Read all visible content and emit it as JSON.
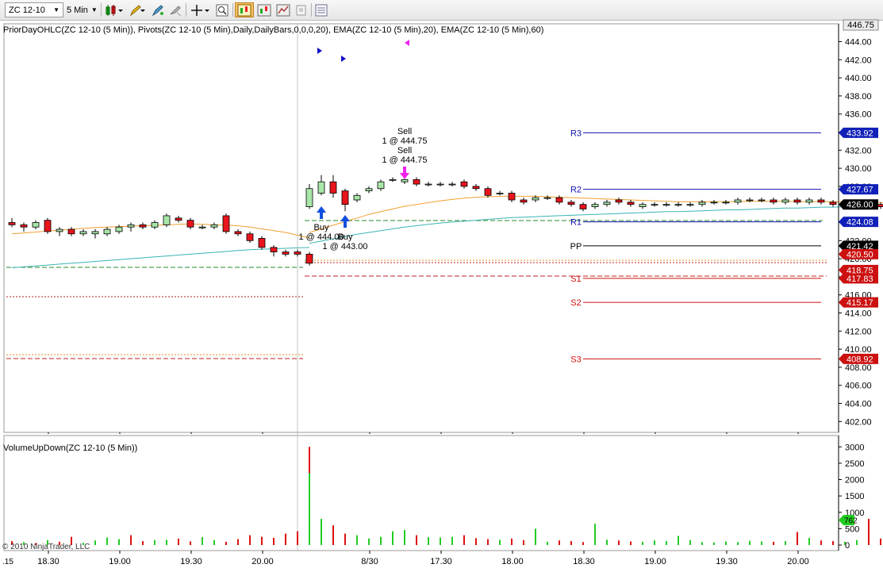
{
  "toolbar": {
    "instrument": "ZC 12-10",
    "interval": "5 Min",
    "icons": [
      "bar-type-icon",
      "drawing-pencil-icon",
      "crosshair-icon",
      "zoom-icon",
      "properties-icon",
      "indicators-icon",
      "strategies-icon",
      "copy-icon",
      "data-box-icon"
    ]
  },
  "indicator_label_price": "PriorDayOHLC(ZC 12-10 (5 Min)), Pivots(ZC 12-10 (5 Min),Daily,DailyBars,0,0,0,20), EMA(ZC 12-10 (5 Min),20), EMA(ZC 12-10 (5 Min),60)",
  "indicator_label_volume": "VolumeUpDown(ZC 12-10 (5 Min))",
  "copyright": "© 2010 NinjaTrader, LLC",
  "left_edge_label": ".15",
  "colors": {
    "up_candle": "#a9e6a9",
    "down_candle": "#e8141c",
    "ema20": "#f0a030",
    "ema60": "#3cb4b4",
    "pivot_resistance": "#1010b0",
    "pivot_support": "#d01010",
    "pp": "#000000",
    "volume_up": "#22cc22",
    "volume_down": "#dd1111"
  },
  "chart_data": {
    "type": "candlestick",
    "price_axis": {
      "min": 401.5,
      "max": 446.75,
      "ticks": [
        446.75,
        444,
        442,
        440,
        438,
        436,
        434,
        432,
        430,
        428,
        426,
        424,
        422,
        420,
        418,
        416,
        414,
        412,
        410,
        408,
        406,
        404,
        402
      ]
    },
    "time_axis": {
      "labels": [
        "18.30",
        "19.00",
        "19.30",
        "20.00",
        "8/30",
        "17.30",
        "18.00",
        "18.30",
        "19.00",
        "19.30",
        "20.00"
      ]
    },
    "price_labels": [
      {
        "value": 433.92,
        "text": "433.92",
        "color": "#1020b8"
      },
      {
        "value": 427.67,
        "text": "427.67",
        "color": "#1020b8"
      },
      {
        "value": 426.0,
        "text": "426.00",
        "color": "#ffffff"
      },
      {
        "value": 424.08,
        "text": "424.08",
        "color": "#1020b8"
      },
      {
        "value": 421.42,
        "text": "421.42",
        "color": "#000000"
      },
      {
        "value": 420.5,
        "text": "420.50",
        "color": "#cc1010"
      },
      {
        "value": 418.75,
        "text": "418.75",
        "color": "#cc1010"
      },
      {
        "value": 417.83,
        "text": "417.83",
        "color": "#cc1010"
      },
      {
        "value": 415.17,
        "text": "415.17",
        "color": "#cc1010"
      },
      {
        "value": 408.92,
        "text": "408.92",
        "color": "#cc1010"
      }
    ],
    "pivots": [
      {
        "name": "R3",
        "value": 433.92
      },
      {
        "name": "R2",
        "value": 427.67
      },
      {
        "name": "R1",
        "value": 424.08
      },
      {
        "name": "PP",
        "value": 421.42
      },
      {
        "name": "S1",
        "value": 417.83
      },
      {
        "name": "S2",
        "value": 415.17
      },
      {
        "name": "S3",
        "value": 408.92
      }
    ],
    "trades": [
      {
        "label": "Sell",
        "detail": "1 @ 444.75"
      },
      {
        "label": "Sell",
        "detail": "1 @ 444.75"
      },
      {
        "label": "Buy",
        "detail": "1 @ 444.00"
      },
      {
        "label": "Buy",
        "detail": "1 @ 443.00"
      }
    ],
    "candles_day1": [
      [
        424.0,
        424.5,
        423.5,
        423.75
      ],
      [
        423.75,
        424.0,
        423.0,
        423.5
      ],
      [
        423.5,
        424.25,
        423.25,
        424.0
      ],
      [
        424.25,
        424.5,
        422.75,
        423.0
      ],
      [
        423.0,
        423.5,
        422.5,
        423.25
      ],
      [
        423.25,
        423.5,
        422.5,
        422.75
      ],
      [
        422.75,
        423.25,
        422.5,
        423.0
      ],
      [
        422.75,
        423.25,
        422.25,
        423.0
      ],
      [
        422.75,
        423.5,
        422.5,
        423.25
      ],
      [
        423.0,
        423.75,
        422.75,
        423.5
      ],
      [
        423.5,
        424.0,
        423.0,
        423.75
      ],
      [
        423.75,
        424.0,
        423.25,
        423.5
      ],
      [
        423.5,
        424.25,
        423.25,
        424.0
      ],
      [
        423.75,
        425.0,
        423.5,
        424.75
      ],
      [
        424.5,
        424.75,
        424.0,
        424.25
      ],
      [
        424.25,
        424.5,
        423.25,
        423.5
      ],
      [
        423.5,
        423.75,
        423.25,
        423.5
      ],
      [
        423.5,
        424.0,
        423.25,
        423.75
      ],
      [
        424.75,
        425.0,
        422.75,
        423.0
      ],
      [
        423.0,
        423.25,
        422.5,
        422.75
      ],
      [
        422.75,
        423.0,
        421.75,
        422.0
      ],
      [
        422.25,
        422.5,
        421.0,
        421.25
      ],
      [
        421.25,
        421.5,
        420.25,
        420.75
      ],
      [
        420.75,
        421.0,
        420.25,
        420.5
      ],
      [
        420.75,
        421.0,
        420.25,
        420.5
      ],
      [
        420.5,
        420.75,
        419.25,
        419.5
      ]
    ],
    "candles_day2": [
      [
        425.75,
        428.25,
        425.5,
        427.75
      ],
      [
        427.25,
        429.25,
        427.0,
        428.5
      ],
      [
        428.5,
        429.25,
        426.75,
        427.25
      ],
      [
        427.5,
        427.75,
        425.25,
        426.0
      ],
      [
        426.5,
        427.25,
        426.25,
        427.0
      ],
      [
        427.5,
        428.0,
        427.25,
        427.75
      ],
      [
        427.75,
        428.75,
        427.5,
        428.5
      ],
      [
        428.75,
        429.0,
        428.5,
        428.75
      ],
      [
        428.5,
        429.25,
        428.25,
        428.75
      ],
      [
        428.75,
        429.0,
        428.0,
        428.25
      ],
      [
        428.25,
        428.5,
        428.0,
        428.25
      ],
      [
        428.25,
        428.5,
        428.0,
        428.25
      ],
      [
        428.25,
        428.5,
        428.0,
        428.25
      ],
      [
        428.5,
        428.75,
        427.75,
        428.0
      ],
      [
        428.0,
        428.25,
        427.5,
        427.75
      ],
      [
        427.75,
        428.0,
        426.75,
        427.0
      ],
      [
        427.25,
        427.5,
        427.0,
        427.25
      ],
      [
        427.25,
        427.5,
        426.25,
        426.5
      ],
      [
        426.5,
        426.75,
        426.0,
        426.25
      ],
      [
        426.5,
        427.0,
        426.25,
        426.75
      ],
      [
        426.75,
        427.0,
        426.5,
        426.75
      ],
      [
        426.75,
        427.0,
        426.0,
        426.25
      ],
      [
        426.25,
        426.5,
        425.75,
        426.0
      ],
      [
        426.0,
        426.25,
        425.25,
        425.5
      ],
      [
        425.75,
        426.25,
        425.5,
        426.0
      ],
      [
        426.0,
        426.5,
        425.75,
        426.25
      ],
      [
        426.5,
        426.75,
        426.0,
        426.25
      ],
      [
        426.25,
        426.5,
        425.75,
        426.0
      ],
      [
        425.75,
        426.25,
        425.5,
        426.0
      ],
      [
        426.0,
        426.25,
        425.75,
        426.0
      ],
      [
        426.0,
        426.25,
        425.75,
        426.0
      ],
      [
        426.0,
        426.25,
        425.75,
        426.0
      ],
      [
        426.0,
        426.25,
        425.75,
        426.0
      ],
      [
        426.0,
        426.5,
        425.75,
        426.25
      ],
      [
        426.25,
        426.5,
        426.0,
        426.25
      ],
      [
        426.25,
        426.5,
        426.0,
        426.25
      ],
      [
        426.25,
        426.75,
        426.0,
        426.5
      ],
      [
        426.5,
        426.75,
        426.25,
        426.5
      ],
      [
        426.5,
        426.75,
        426.25,
        426.5
      ],
      [
        426.5,
        426.75,
        426.0,
        426.25
      ],
      [
        426.25,
        426.75,
        426.0,
        426.5
      ],
      [
        426.5,
        426.75,
        426.0,
        426.25
      ],
      [
        426.25,
        426.75,
        426.0,
        426.5
      ],
      [
        426.5,
        426.75,
        426.0,
        426.25
      ],
      [
        426.25,
        426.5,
        425.75,
        426.0
      ],
      [
        426.0,
        426.25,
        425.75,
        426.0
      ],
      [
        426.0,
        426.25,
        425.75,
        426.0
      ],
      [
        426.0,
        426.25,
        425.75,
        426.0
      ],
      [
        426.0,
        426.25,
        425.5,
        425.75
      ],
      [
        425.25,
        426.75,
        424.75,
        426.0
      ]
    ],
    "ema20_day1": [
      422.75,
      422.85,
      422.95,
      423.05,
      423.15,
      423.25,
      423.35,
      423.45,
      423.5,
      423.55,
      423.6,
      423.65,
      423.7,
      423.75,
      423.8,
      423.85,
      423.8,
      423.75,
      423.7,
      423.65,
      423.5,
      423.3,
      423.1,
      422.9,
      422.6,
      422.3
    ],
    "ema60_day1": [
      419.0,
      419.1,
      419.2,
      419.3,
      419.4,
      419.5,
      419.6,
      419.7,
      419.8,
      419.9,
      420.0,
      420.1,
      420.2,
      420.3,
      420.4,
      420.5,
      420.6,
      420.7,
      420.8,
      420.9,
      421.0,
      421.05,
      421.1,
      421.15,
      421.2,
      421.25
    ],
    "ema20_day2": [
      422.9,
      423.3,
      423.7,
      424.1,
      424.5,
      424.9,
      425.2,
      425.5,
      425.8,
      426.0,
      426.2,
      426.4,
      426.55,
      426.7,
      426.8,
      426.85,
      426.9,
      426.9,
      426.9,
      426.9,
      426.85,
      426.8,
      426.75,
      426.7,
      426.65,
      426.6,
      426.55,
      426.5,
      426.45,
      426.4,
      426.35,
      426.3,
      426.3,
      426.3,
      426.3,
      426.3,
      426.3,
      426.35,
      426.35,
      426.35,
      426.35,
      426.3,
      426.3,
      426.3,
      426.3,
      426.3,
      426.25,
      426.25,
      426.2,
      426.2
    ],
    "ema60_day2": [
      421.7,
      421.95,
      422.2,
      422.45,
      422.7,
      422.9,
      423.1,
      423.3,
      423.5,
      423.65,
      423.8,
      423.95,
      424.05,
      424.15,
      424.25,
      424.35,
      424.45,
      424.55,
      424.6,
      424.65,
      424.7,
      424.75,
      424.8,
      424.85,
      424.9,
      424.95,
      425.0,
      425.05,
      425.1,
      425.15,
      425.2,
      425.2,
      425.25,
      425.3,
      425.35,
      425.4,
      425.4,
      425.45,
      425.5,
      425.55,
      425.6,
      425.6,
      425.65,
      425.7,
      425.7,
      425.75,
      425.75,
      425.8,
      425.8,
      425.85
    ],
    "volume_axis": {
      "max": 3100,
      "ticks": [
        3000,
        2500,
        2000,
        1500,
        1000,
        500,
        0
      ],
      "last_label": "762"
    },
    "volume_day1": [
      120,
      90,
      60,
      150,
      100,
      250,
      70,
      140,
      230,
      180,
      300,
      120,
      150,
      160,
      200,
      110,
      240,
      150,
      100,
      180,
      300,
      250,
      220,
      350,
      420,
      3000
    ],
    "volume_day2": [
      2200,
      800,
      600,
      350,
      300,
      200,
      250,
      420,
      460,
      300,
      240,
      230,
      250,
      300,
      210,
      180,
      160,
      200,
      150,
      500,
      100,
      140,
      120,
      90,
      650,
      160,
      140,
      110,
      100,
      140,
      120,
      280,
      150,
      90,
      80,
      110,
      90,
      130,
      110,
      100,
      120,
      400,
      220,
      140,
      120,
      100,
      150,
      800,
      200,
      770
    ],
    "volume_up_day1": [
      false,
      true,
      false,
      true,
      false,
      false,
      true,
      true,
      true,
      true,
      false,
      false,
      true,
      true,
      false,
      false,
      true,
      true,
      false,
      false,
      false,
      false,
      false,
      false,
      false,
      false
    ],
    "volume_up_day2": [
      true,
      true,
      false,
      false,
      true,
      true,
      true,
      true,
      true,
      false,
      true,
      true,
      true,
      false,
      false,
      false,
      true,
      false,
      false,
      true,
      true,
      false,
      false,
      false,
      true,
      true,
      false,
      false,
      true,
      true,
      true,
      true,
      true,
      true,
      true,
      true,
      true,
      true,
      true,
      false,
      true,
      false,
      true,
      false,
      false,
      true,
      true,
      false,
      false,
      true
    ]
  }
}
